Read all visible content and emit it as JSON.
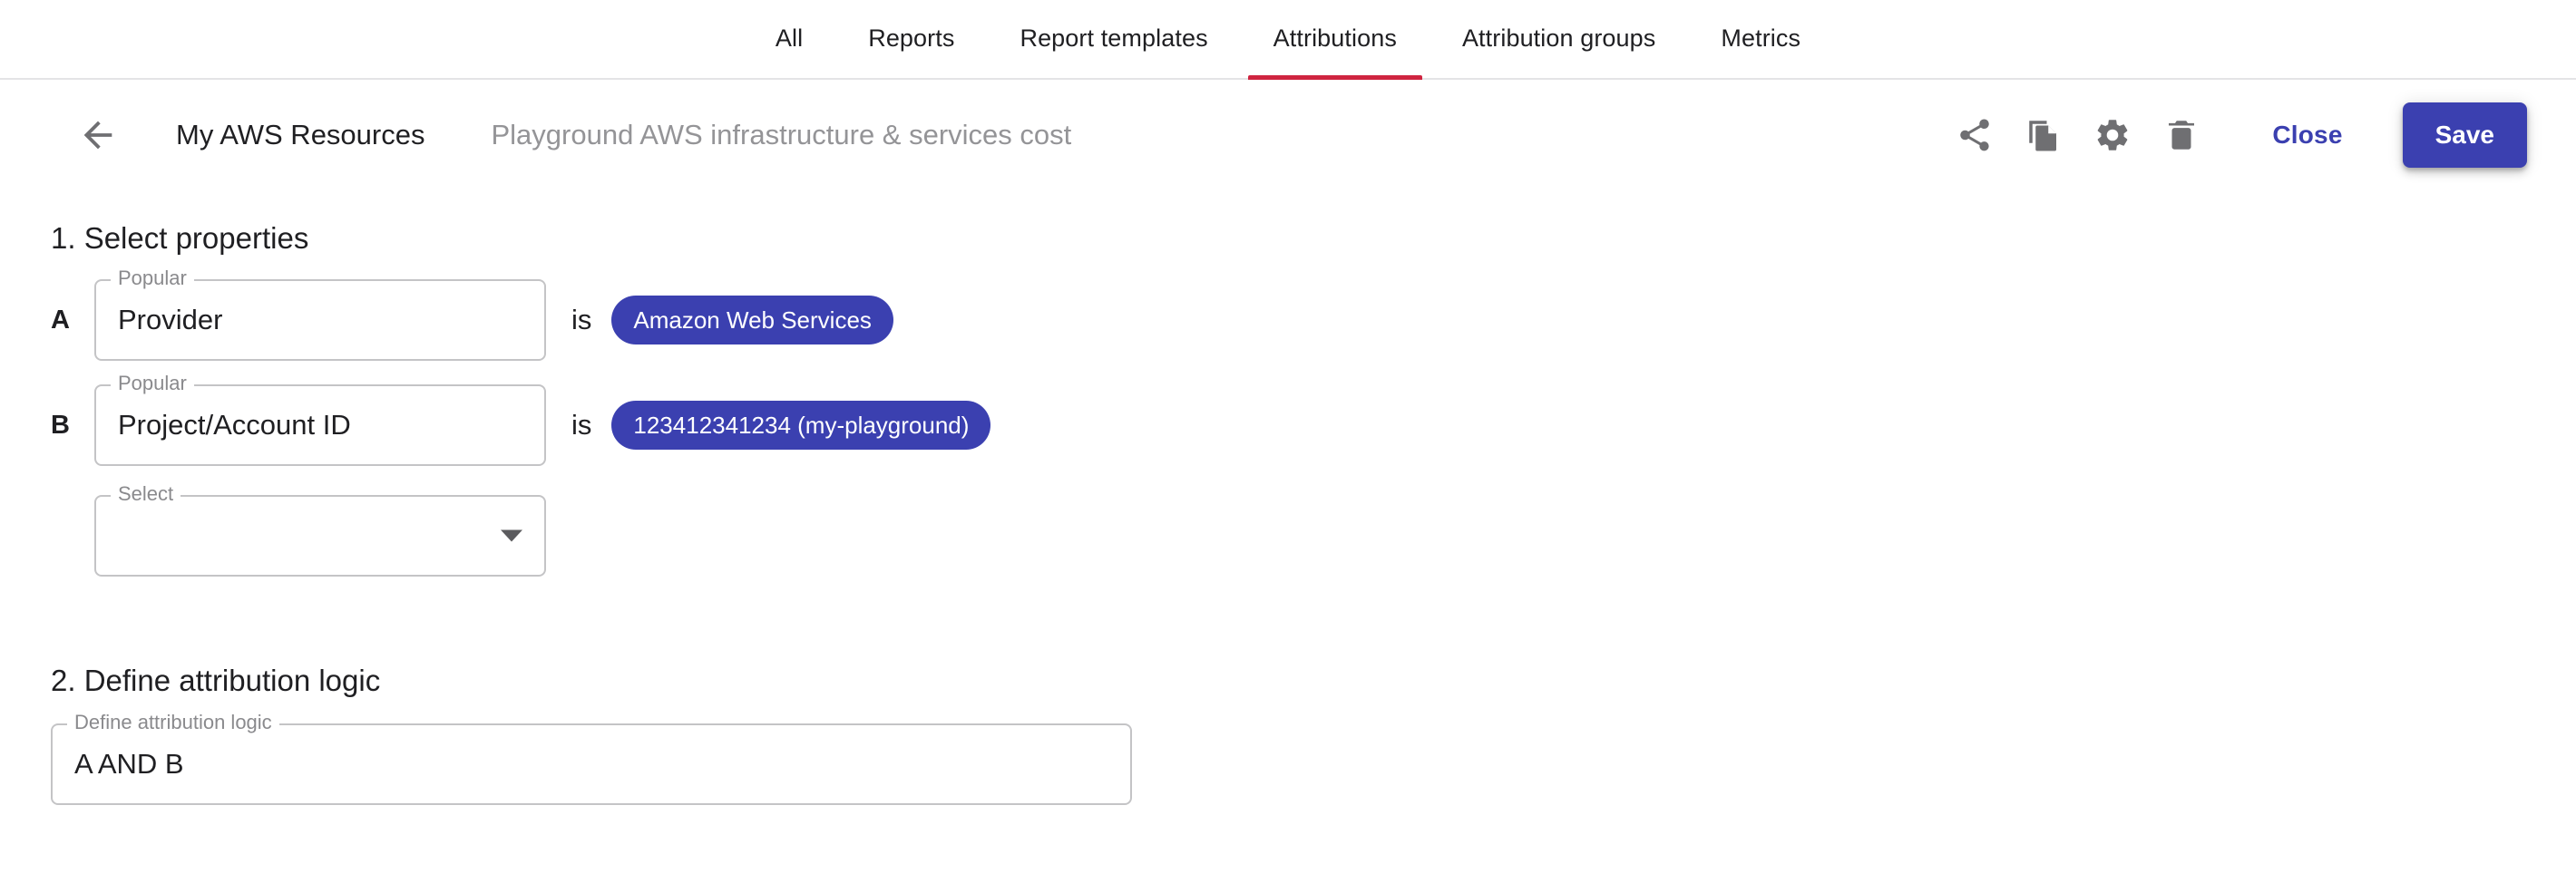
{
  "tabs": [
    {
      "label": "All",
      "active": false
    },
    {
      "label": "Reports",
      "active": false
    },
    {
      "label": "Report templates",
      "active": false
    },
    {
      "label": "Attributions",
      "active": true
    },
    {
      "label": "Attribution groups",
      "active": false
    },
    {
      "label": "Metrics",
      "active": false
    }
  ],
  "header": {
    "back_icon": "arrow-left-icon",
    "title": "My AWS Resources",
    "subtitle": "Playground AWS infrastructure & services cost",
    "actions": [
      {
        "icon": "share-icon",
        "name": "share-button"
      },
      {
        "icon": "copy-icon",
        "name": "duplicate-button"
      },
      {
        "icon": "gear-icon",
        "name": "settings-button"
      },
      {
        "icon": "trash-icon",
        "name": "delete-button"
      }
    ],
    "close_label": "Close",
    "save_label": "Save"
  },
  "sections": {
    "select_properties": {
      "title": "1. Select properties",
      "rows": [
        {
          "letter": "A",
          "field_legend": "Popular",
          "field_value": "Provider",
          "operator": "is",
          "chip": "Amazon Web Services"
        },
        {
          "letter": "B",
          "field_legend": "Popular",
          "field_value": "Project/Account ID",
          "operator": "is",
          "chip": "123412341234 (my-playground)"
        }
      ],
      "empty_select": {
        "legend": "Select",
        "value": "",
        "caret_icon": "chevron-down-icon"
      }
    },
    "attribution_logic": {
      "title": "2. Define attribution logic",
      "field_legend": "Define attribution logic",
      "field_value": "A AND B"
    }
  },
  "colors": {
    "accent": "#3b40b0",
    "active_tab_underline": "#cf2440",
    "border": "#c4c4c6",
    "muted_text": "#949497"
  }
}
